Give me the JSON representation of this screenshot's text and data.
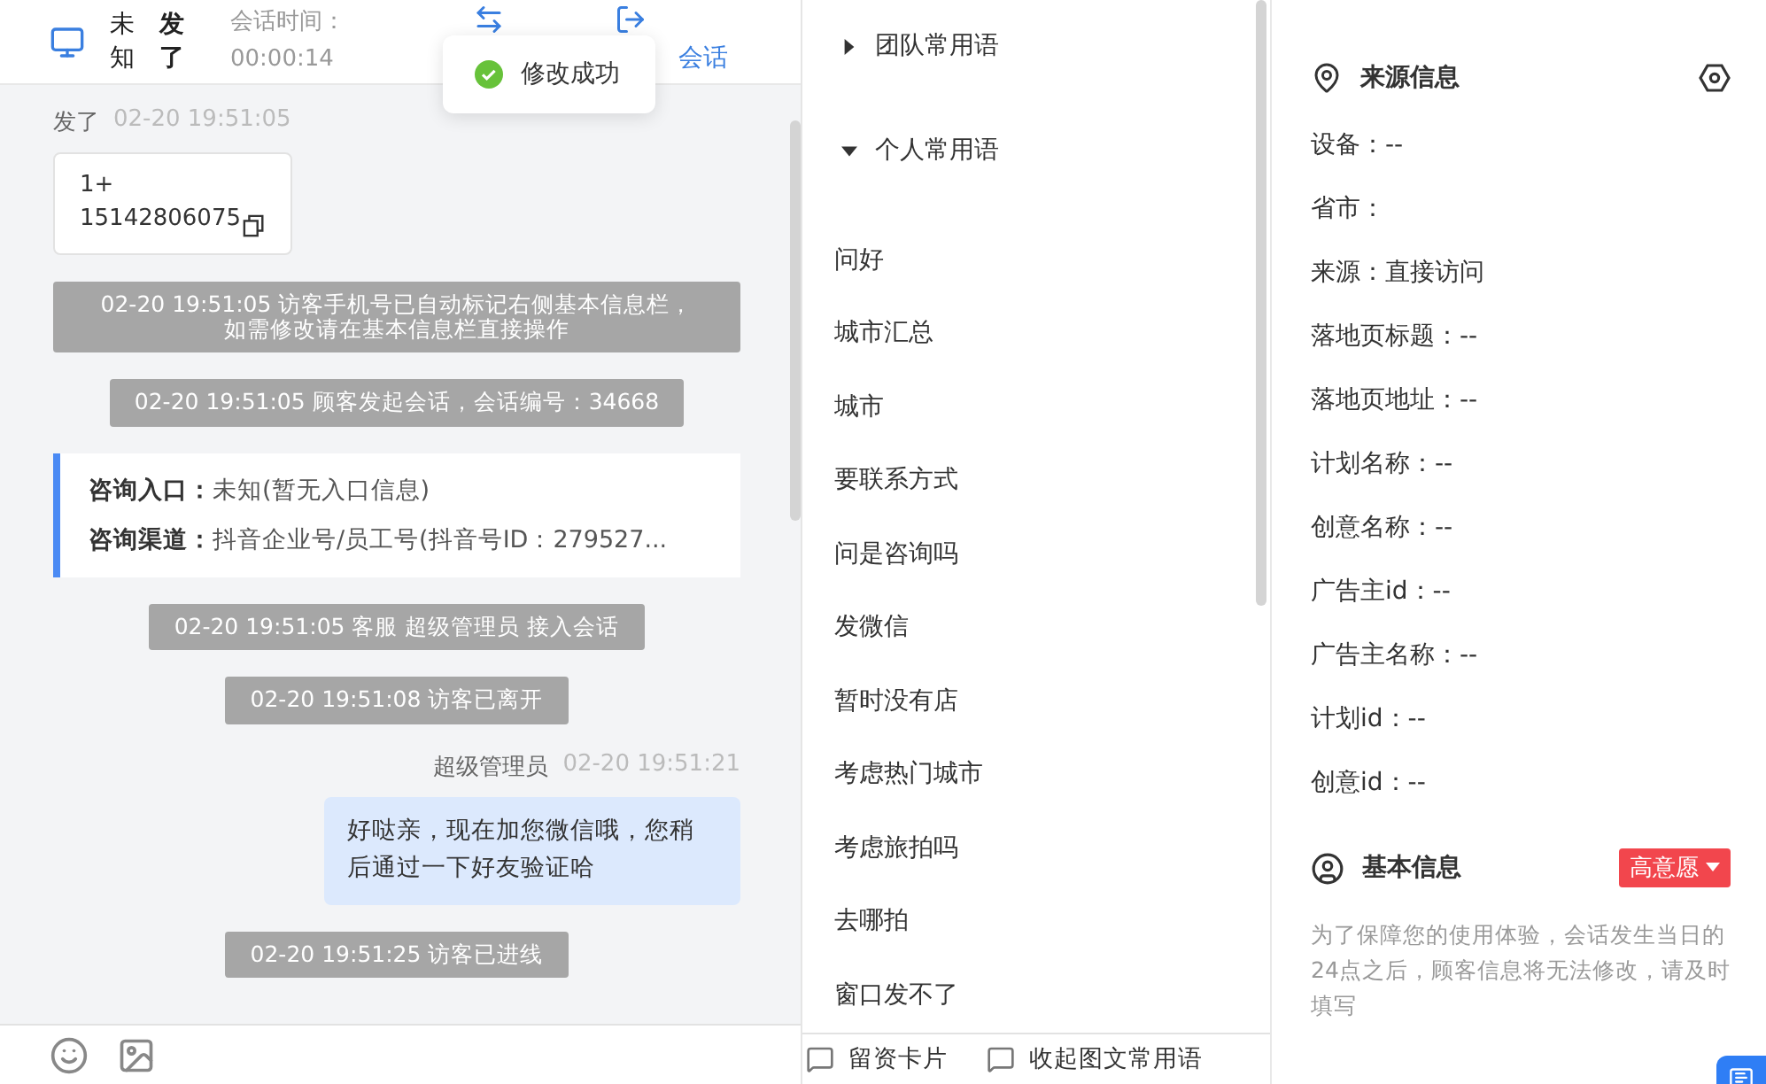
{
  "header": {
    "visitor_name": "未知",
    "visitor_tag": "发了",
    "time_label": "会话时间：",
    "time_value": "00:00:14",
    "actions": [
      {
        "kind": "transfer"
      },
      {
        "kind": "end",
        "label": "会话"
      }
    ]
  },
  "toast": {
    "text": "修改成功"
  },
  "messages": [
    {
      "kind": "visitor",
      "sender": "发了",
      "time": "02-20 19:51:05",
      "lines": [
        "1+",
        "15142806075"
      ]
    },
    {
      "kind": "system",
      "lines": [
        "02-20 19:51:05 访客手机号已自动标记右侧基本信息栏，",
        "如需修改请在基本信息栏直接操作"
      ]
    },
    {
      "kind": "system",
      "lines": [
        "02-20 19:51:05 顾客发起会话，会话编号：34668"
      ]
    },
    {
      "kind": "info",
      "rows": [
        {
          "label": "咨询入口：",
          "value": "未知(暂无入口信息)"
        },
        {
          "label": "咨询渠道：",
          "value": "抖音企业号/员工号(抖音号ID：279527..."
        }
      ]
    },
    {
      "kind": "system",
      "lines": [
        "02-20 19:51:05 客服 超级管理员 接入会话"
      ]
    },
    {
      "kind": "system",
      "lines": [
        "02-20 19:51:08 访客已离开"
      ]
    },
    {
      "kind": "agent",
      "sender": "超级管理员",
      "time": "02-20 19:51:21",
      "text": "好哒亲，现在加您微信哦，您稍后通过一下好友验证哈"
    },
    {
      "kind": "system",
      "lines": [
        "02-20 19:51:25 访客已进线"
      ]
    }
  ],
  "phrases": {
    "groups": [
      {
        "title": "团队常用语",
        "expanded": false
      },
      {
        "title": "个人常用语",
        "expanded": true,
        "items": [
          "问好",
          "城市汇总",
          "城市",
          "要联系方式",
          "问是咨询吗",
          "发微信",
          "暂时没有店",
          "考虑热门城市",
          "考虑旅拍吗",
          "去哪拍",
          "窗口发不了"
        ]
      }
    ],
    "actions": [
      "留资卡片",
      "收起图文常用语"
    ]
  },
  "sections": [
    {
      "kind": "source",
      "title": "来源信息",
      "fields": [
        "设备：--",
        "省市：",
        "来源：直接访问",
        "落地页标题：--",
        "落地页地址：--",
        "计划名称：--",
        "创意名称：--",
        "广告主id：--",
        "广告主名称：--",
        "计划id：--",
        "创意id：--"
      ]
    },
    {
      "kind": "basic",
      "title": "基本信息",
      "badge": "高意愿",
      "note": "为了保障您的使用体验，会话发生当日的24点之后，顾客信息将无法修改，请及时填写"
    }
  ]
}
